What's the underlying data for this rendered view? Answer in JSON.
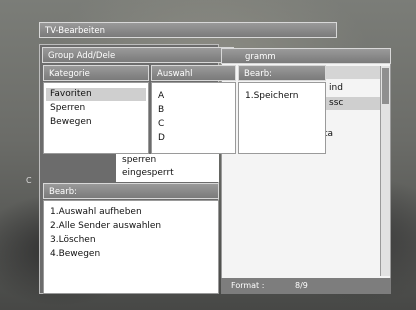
{
  "window_title": "TV-Bearbeiten",
  "group_dialog_title": "Group Add/Dele",
  "back_panel_title": "gramm",
  "category": {
    "header": "Kategorie",
    "items": [
      "Favoriten",
      "Sperren",
      "Bewegen"
    ]
  },
  "selection": {
    "header": "Auswahl",
    "items": [
      "A",
      "B",
      "C",
      "D"
    ]
  },
  "edit_popup": {
    "header": "Bearb:",
    "items": [
      "1.Speichern"
    ]
  },
  "middle_list": {
    "items": [
      "sperren",
      "eingesperrt"
    ]
  },
  "edit_help": {
    "header": "Bearb:",
    "items": [
      "1.Auswahl aufheben",
      "2.Alle Sender auswahlen",
      "3.Löschen",
      "4.Bewegen"
    ]
  },
  "right_fragments": [
    "ind",
    "ssc",
    "ta"
  ],
  "footer": {
    "label": "Format :",
    "value": "8/9"
  },
  "left_edge_fragment": "C"
}
